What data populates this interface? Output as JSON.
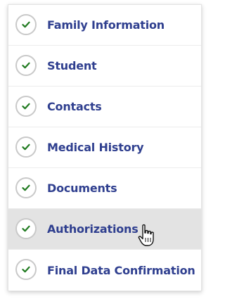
{
  "menu": {
    "items": [
      {
        "label": "Family Information",
        "status": "complete"
      },
      {
        "label": "Student",
        "status": "complete"
      },
      {
        "label": "Contacts",
        "status": "complete"
      },
      {
        "label": "Medical History",
        "status": "complete"
      },
      {
        "label": "Documents",
        "status": "complete"
      },
      {
        "label": "Authorizations",
        "status": "complete",
        "hovered": true
      },
      {
        "label": "Final Data Confirmation",
        "status": "complete"
      }
    ]
  },
  "colors": {
    "label": "#2f3f8f",
    "check": "#1f7a1f",
    "check_ring": "#c9c9c9",
    "hover_bg": "#e3e3e3"
  },
  "icons": {
    "status": "checkmark-circle-icon",
    "cursor": "hand-pointer-cursor-icon"
  }
}
